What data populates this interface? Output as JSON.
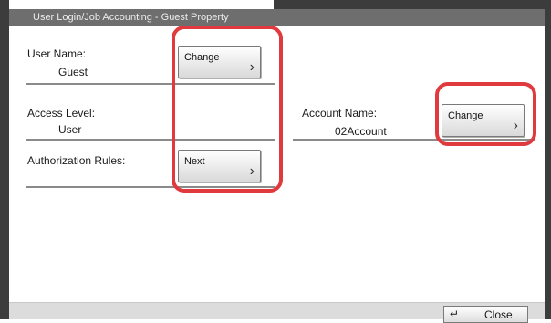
{
  "window": {
    "title": "User Login/Job Accounting - Guest Property"
  },
  "user_name": {
    "label": "User Name:",
    "value": "Guest",
    "button_label": "Change"
  },
  "access_level": {
    "label": "Access Level:",
    "value": "User"
  },
  "authorization_rules": {
    "label": "Authorization Rules:",
    "button_label": "Next"
  },
  "account_name": {
    "label": "Account Name:",
    "value": "02Account",
    "button_label": "Change"
  },
  "footer": {
    "close_label": "Close"
  },
  "icons": {
    "chevron": "chevron-right-icon",
    "enter": "enter-icon"
  },
  "colors": {
    "highlight": "#e0393e",
    "title_bar": "#6e6e6e"
  }
}
